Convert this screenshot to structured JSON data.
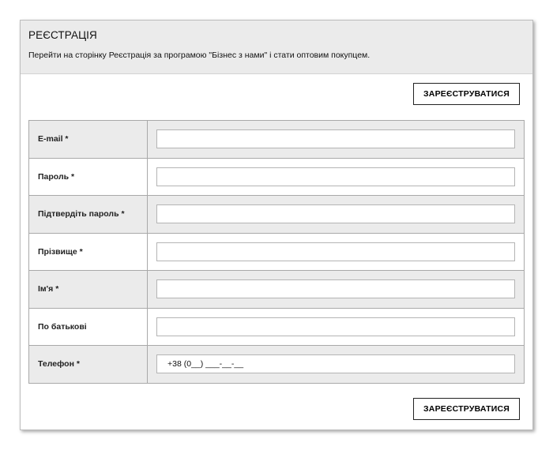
{
  "header": {
    "title": "РЕЄСТРАЦІЯ",
    "description": "Перейти на сторінку Реєстрація за програмою \"Бізнес з нами\" і стати оптовим покупцем."
  },
  "buttons": {
    "register_top": "ЗАРЕЄСТРУВАТИСЯ",
    "register_bottom": "ЗАРЕЄСТРУВАТИСЯ"
  },
  "form": {
    "email_label": "E-mail *",
    "password_label": "Пароль *",
    "confirm_label": "Підтвердіть пароль *",
    "surname_label": "Прізвище *",
    "name_label": "Ім'я *",
    "patronymic_label": "По батькові",
    "phone_label": "Телефон *",
    "phone_value": "+38 (0__) ___-__-__"
  }
}
